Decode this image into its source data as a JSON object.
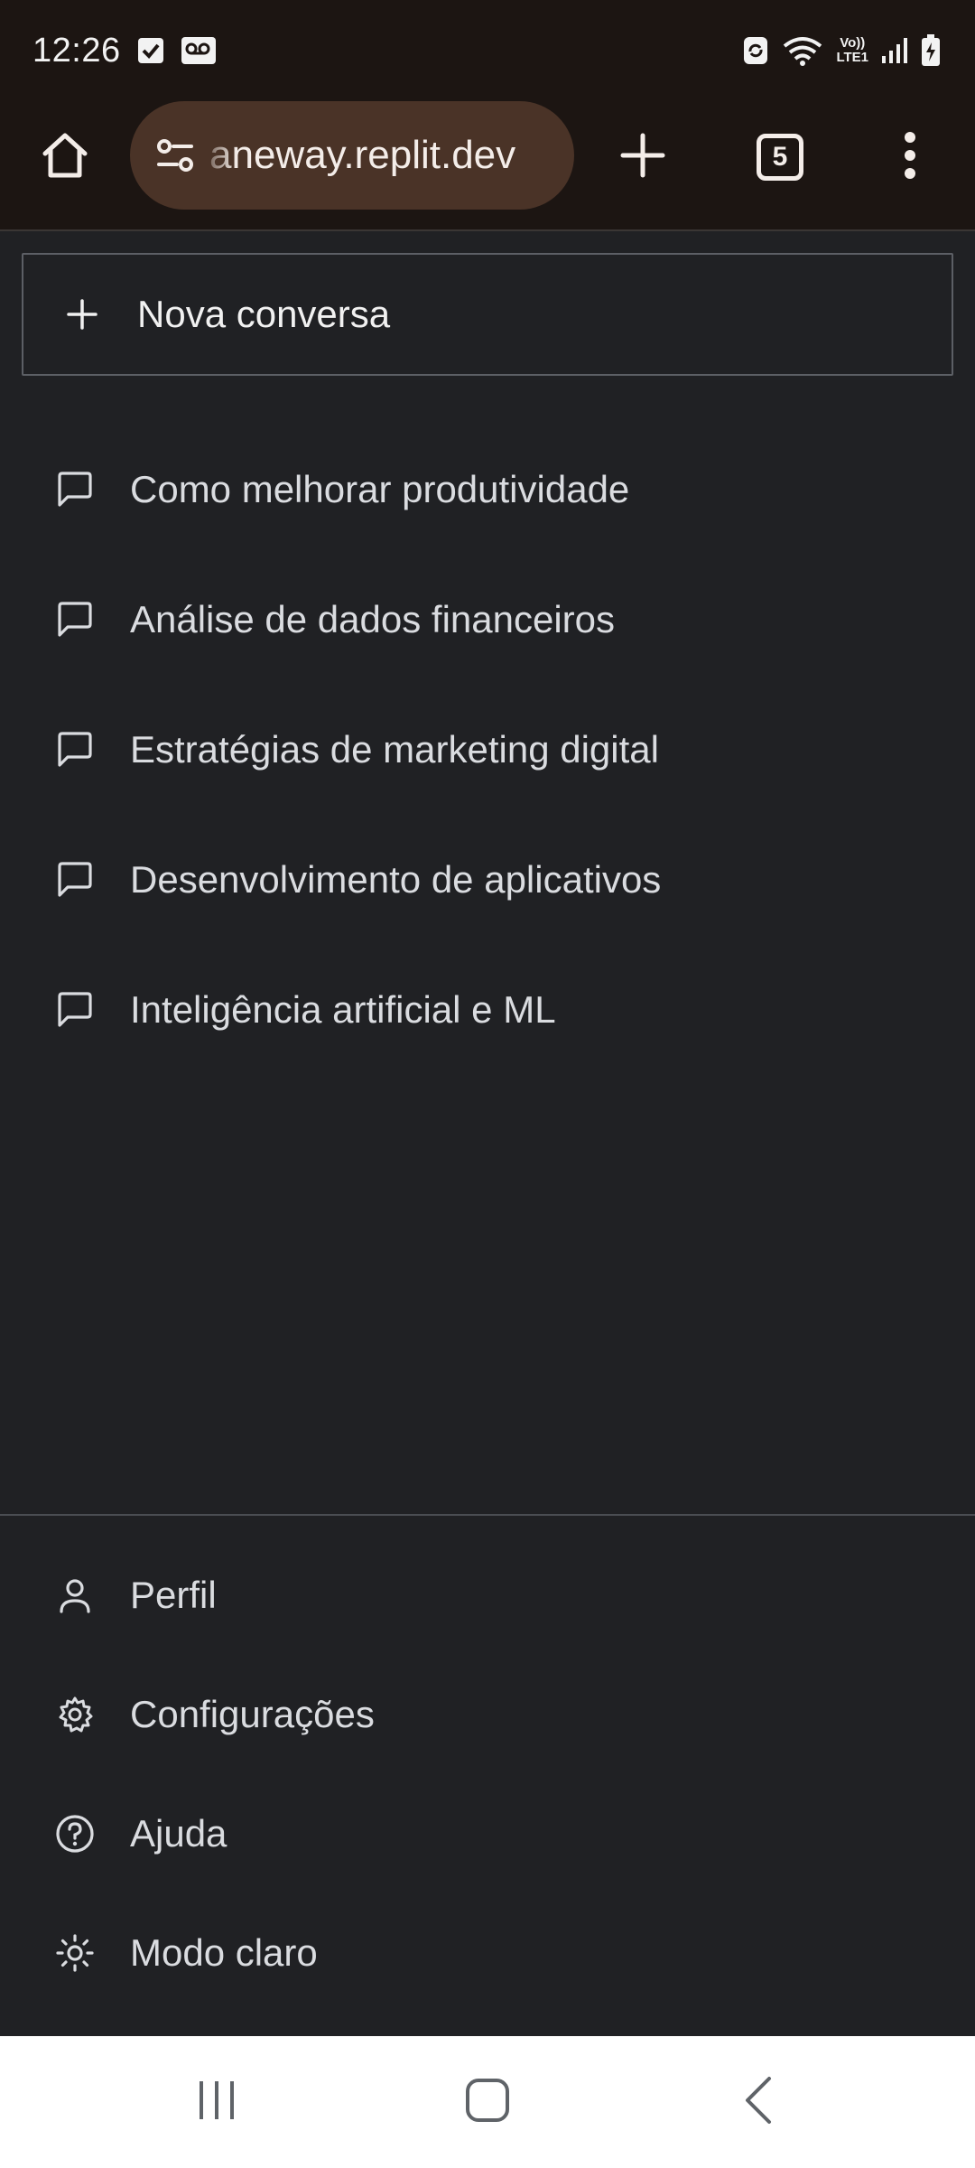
{
  "status_bar": {
    "time": "12:26",
    "network_label_top": "Vo))",
    "network_label_bottom": "LTE1",
    "icons": [
      "checkbox-notification-icon",
      "voicemail-icon",
      "sync-icon",
      "wifi-icon",
      "signal-icon",
      "battery-charging-icon"
    ]
  },
  "browser": {
    "url": "aneway.replit.dev",
    "tab_count": "5",
    "icons": [
      "home-icon",
      "site-settings-icon",
      "new-tab-plus-icon",
      "tab-switcher-icon",
      "more-vertical-icon"
    ]
  },
  "sidebar": {
    "new_chat_label": "Nova conversa",
    "conversations": [
      {
        "label": "Como melhorar produtividade",
        "icon": "chat-bubble-icon"
      },
      {
        "label": "Análise de dados financeiros",
        "icon": "chat-bubble-icon"
      },
      {
        "label": "Estratégias de marketing digital",
        "icon": "chat-bubble-icon"
      },
      {
        "label": "Desenvolvimento de aplicativos",
        "icon": "chat-bubble-icon"
      },
      {
        "label": "Inteligência artificial e ML",
        "icon": "chat-bubble-icon"
      }
    ],
    "bottom_items": [
      {
        "label": "Perfil",
        "icon": "user-icon"
      },
      {
        "label": "Configurações",
        "icon": "gear-icon"
      },
      {
        "label": "Ajuda",
        "icon": "help-circle-icon"
      },
      {
        "label": "Modo claro",
        "icon": "sun-icon"
      }
    ]
  },
  "nav_bar": {
    "icons": [
      "recent-apps-icon",
      "home-button-icon",
      "back-icon"
    ]
  },
  "colors": {
    "chrome_background": "#1c1512",
    "url_pill": "#4a3327",
    "page_background": "#202124",
    "text_primary": "#dadce0",
    "border": "#5c5f65"
  }
}
